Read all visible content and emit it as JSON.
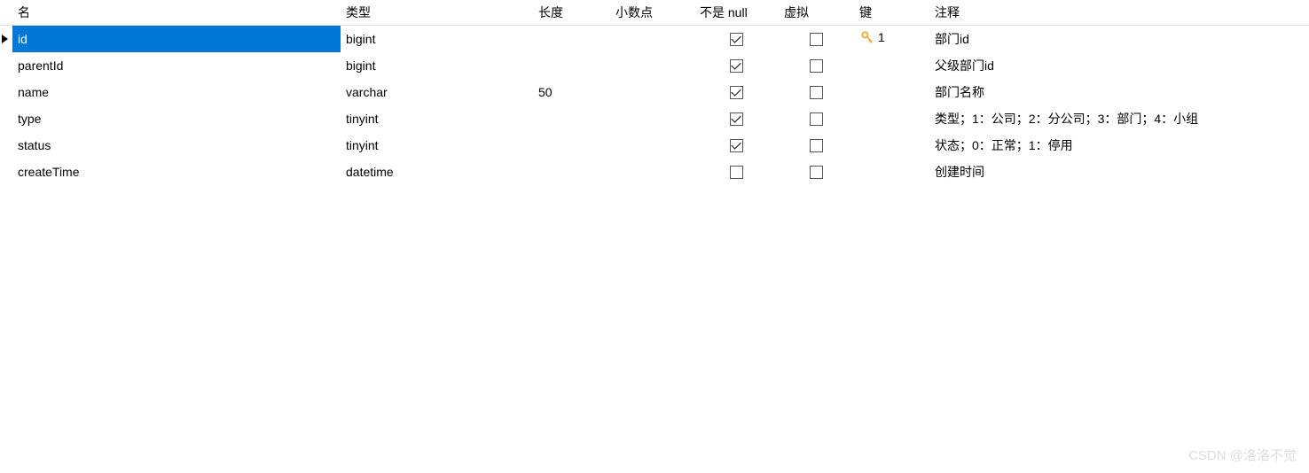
{
  "headers": {
    "name": "名",
    "type": "类型",
    "length": "长度",
    "decimal": "小数点",
    "notnull": "不是 null",
    "virtual": "虚拟",
    "key": "键",
    "comment": "注释"
  },
  "rows": [
    {
      "selected": true,
      "name": "id",
      "type": "bigint",
      "length": "",
      "decimal": "",
      "notnull": true,
      "virtual": false,
      "key": "1",
      "hasKey": true,
      "comment": "部门id"
    },
    {
      "selected": false,
      "name": "parentId",
      "type": "bigint",
      "length": "",
      "decimal": "",
      "notnull": true,
      "virtual": false,
      "key": "",
      "hasKey": false,
      "comment": "父级部门id"
    },
    {
      "selected": false,
      "name": "name",
      "type": "varchar",
      "length": "50",
      "decimal": "",
      "notnull": true,
      "virtual": false,
      "key": "",
      "hasKey": false,
      "comment": "部门名称"
    },
    {
      "selected": false,
      "name": "type",
      "type": "tinyint",
      "length": "",
      "decimal": "",
      "notnull": true,
      "virtual": false,
      "key": "",
      "hasKey": false,
      "comment": "类型；1：公司；2：分公司；3：部门；4：小组"
    },
    {
      "selected": false,
      "name": "status",
      "type": "tinyint",
      "length": "",
      "decimal": "",
      "notnull": true,
      "virtual": false,
      "key": "",
      "hasKey": false,
      "comment": "状态；0：正常；1：停用"
    },
    {
      "selected": false,
      "name": "createTime",
      "type": "datetime",
      "length": "",
      "decimal": "",
      "notnull": false,
      "virtual": false,
      "key": "",
      "hasKey": false,
      "comment": "创建时间"
    }
  ],
  "watermark": "CSDN @洛洛不觉"
}
